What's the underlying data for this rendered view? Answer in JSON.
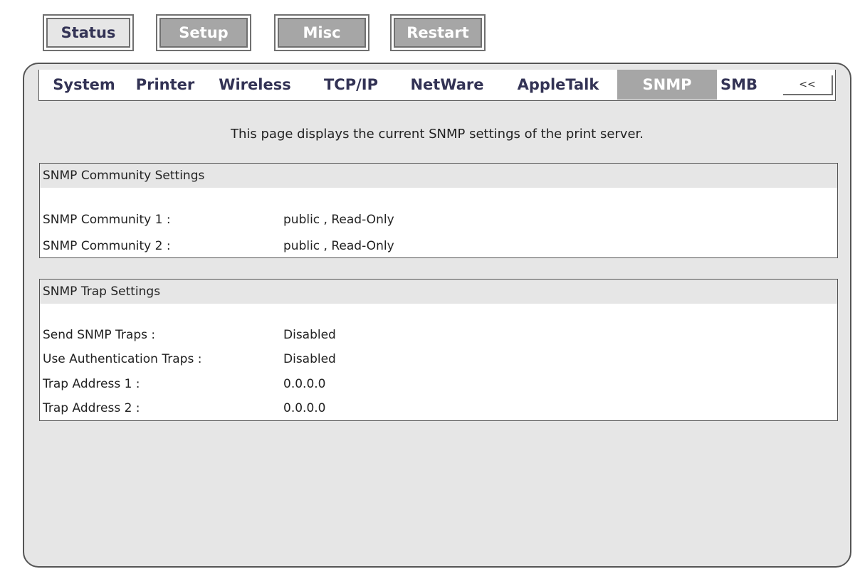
{
  "top_nav": {
    "status": "Status",
    "setup": "Setup",
    "misc": "Misc",
    "restart": "Restart"
  },
  "tabs": [
    {
      "label": "System"
    },
    {
      "label": "Printer"
    },
    {
      "label": "Wireless"
    },
    {
      "label": "TCP/IP"
    },
    {
      "label": "NetWare"
    },
    {
      "label": "AppleTalk"
    },
    {
      "label": "SNMP",
      "active": true
    },
    {
      "label": "SMB"
    }
  ],
  "collapse_label": "<<",
  "description": "This page displays the current SNMP settings of the print server.",
  "community": {
    "title": "SNMP Community Settings",
    "rows": [
      {
        "label": "SNMP Community 1 :",
        "value": "public , Read-Only"
      },
      {
        "label": "SNMP Community 2 :",
        "value": "public , Read-Only"
      }
    ]
  },
  "trap": {
    "title": "SNMP Trap Settings",
    "rows": [
      {
        "label": "Send SNMP Traps :",
        "value": "Disabled"
      },
      {
        "label": "Use Authentication Traps :",
        "value": "Disabled"
      },
      {
        "label": "Trap Address 1 :",
        "value": "0.0.0.0"
      },
      {
        "label": "Trap Address 2 :",
        "value": "0.0.0.0"
      }
    ]
  },
  "colors": {
    "panel_bg": "#e6e6e6",
    "active_bg": "#a6a6a6",
    "text_dark": "#333355"
  }
}
